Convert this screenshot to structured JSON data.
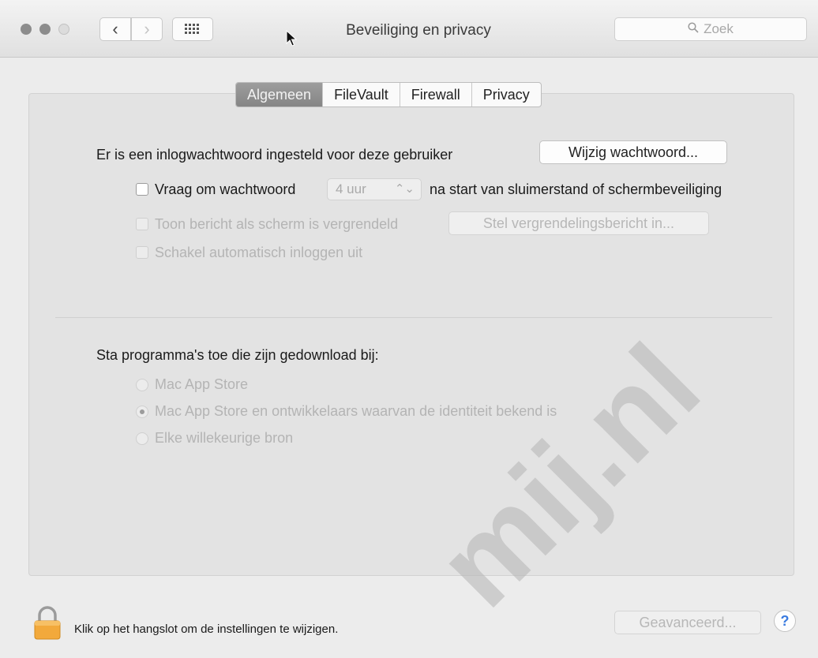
{
  "window": {
    "title": "Beveiliging en privacy",
    "search_placeholder": "Zoek",
    "back_icon": "‹",
    "forward_icon": "›"
  },
  "tabs": [
    {
      "label": "Algemeen",
      "active": true
    },
    {
      "label": "FileVault",
      "active": false
    },
    {
      "label": "Firewall",
      "active": false
    },
    {
      "label": "Privacy",
      "active": false
    }
  ],
  "general": {
    "password_text": "Er is een inlogwachtwoord ingesteld voor deze gebruiker",
    "change_password_button": "Wijzig wachtwoord...",
    "require_password_label": "Vraag om wachtwoord",
    "require_password_value": "4 uur",
    "require_password_suffix": "na start van sluimerstand of schermbeveiliging",
    "show_message_label": "Toon bericht als scherm is vergrendeld",
    "set_message_button": "Stel vergrendelingsbericht in...",
    "disable_autologin_label": "Schakel automatisch inloggen uit"
  },
  "downloads": {
    "heading": "Sta programma's toe die zijn gedownload bij:",
    "options": [
      {
        "label": "Mac App Store",
        "selected": false
      },
      {
        "label": "Mac App Store en ontwikkelaars waarvan de identiteit bekend is",
        "selected": true
      },
      {
        "label": "Elke willekeurige bron",
        "selected": false
      }
    ]
  },
  "footer": {
    "lock_text": "Klik op het hangslot om de instellingen te wijzigen.",
    "advanced_button": "Geavanceerd...",
    "help_label": "?"
  },
  "watermark": "mij.nl"
}
